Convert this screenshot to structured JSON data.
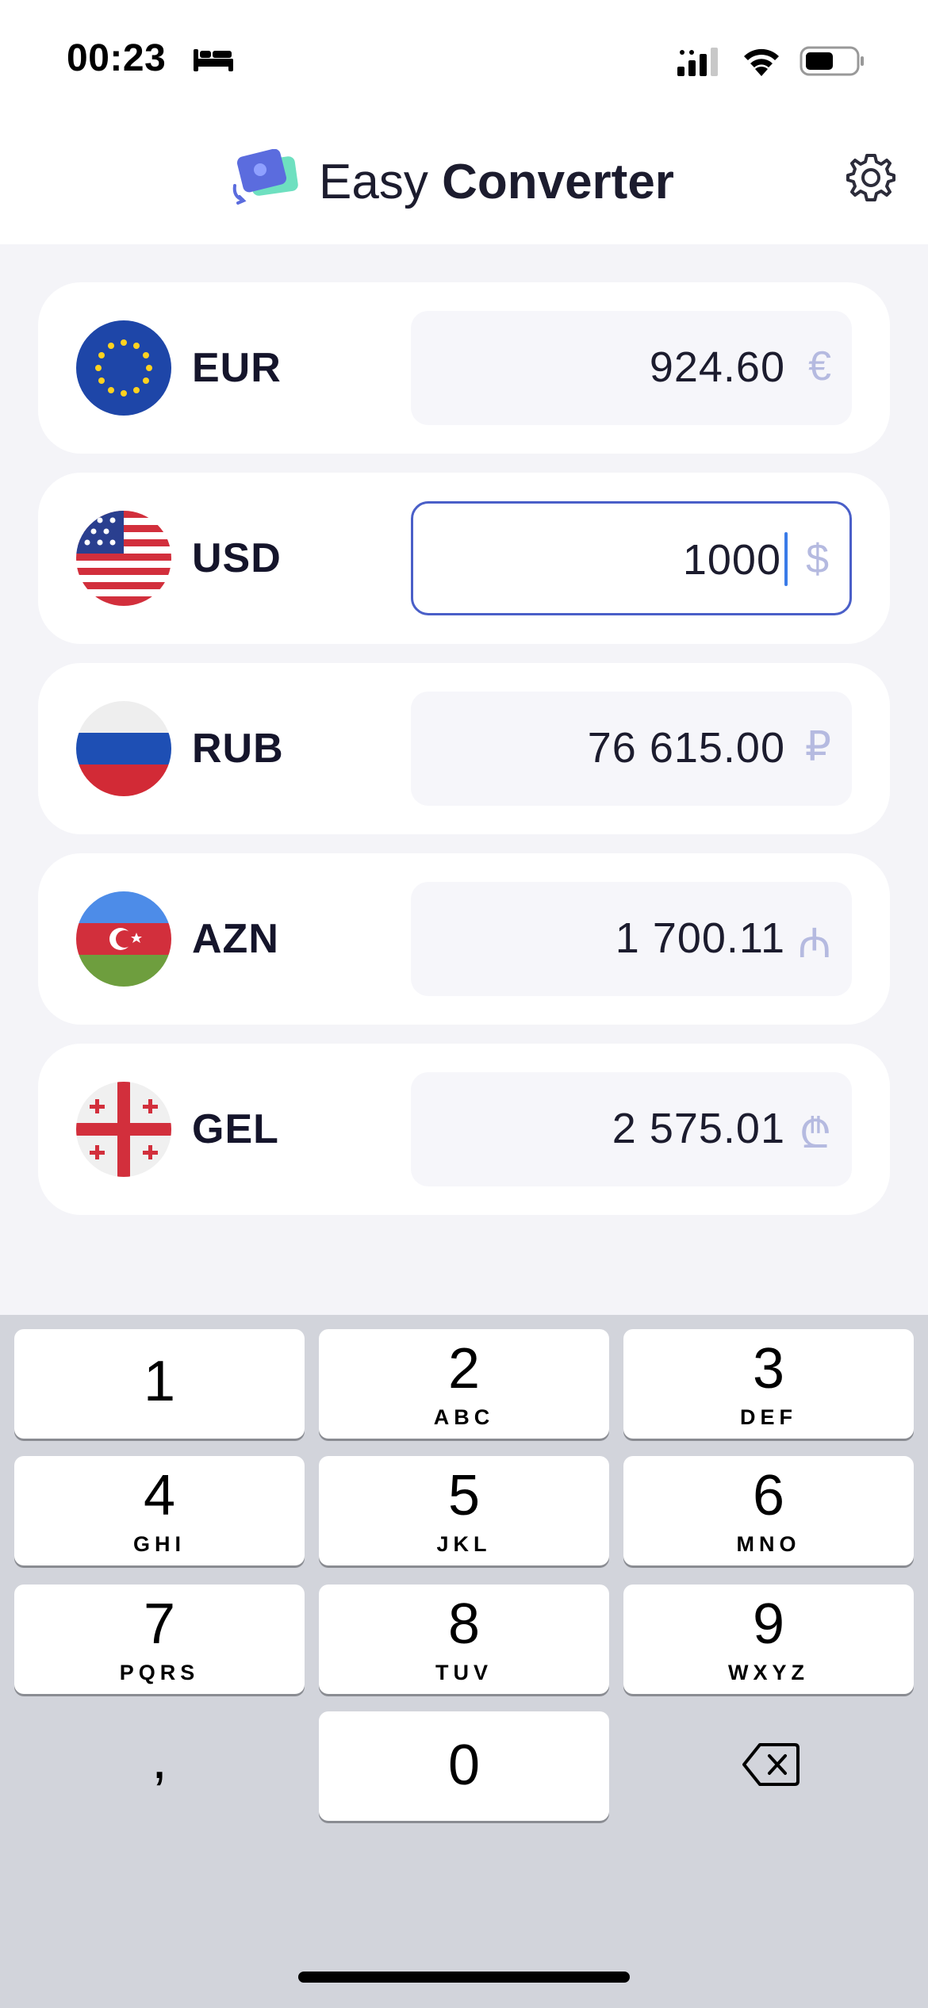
{
  "status_bar": {
    "time": "00:23"
  },
  "header": {
    "title_light": "Easy ",
    "title_bold": "Converter"
  },
  "currencies": [
    {
      "code": "EUR",
      "amount": "924.60",
      "symbol": "€",
      "active": false
    },
    {
      "code": "USD",
      "amount": "1000",
      "symbol": "$",
      "active": true
    },
    {
      "code": "RUB",
      "amount": "76 615.00",
      "symbol": "₽",
      "active": false
    },
    {
      "code": "AZN",
      "amount": "1 700.11",
      "symbol": "₼",
      "active": false
    },
    {
      "code": "GEL",
      "amount": "2 575.01",
      "symbol": "₾",
      "active": false
    }
  ],
  "keyboard": {
    "keys": [
      {
        "num": "1",
        "letters": ""
      },
      {
        "num": "2",
        "letters": "ABC"
      },
      {
        "num": "3",
        "letters": "DEF"
      },
      {
        "num": "4",
        "letters": "GHI"
      },
      {
        "num": "5",
        "letters": "JKL"
      },
      {
        "num": "6",
        "letters": "MNO"
      },
      {
        "num": "7",
        "letters": "PQRS"
      },
      {
        "num": "8",
        "letters": "TUV"
      },
      {
        "num": "9",
        "letters": "WXYZ"
      }
    ],
    "zero": "0",
    "comma": ","
  },
  "colors": {
    "accent": "#4a5fc8",
    "caret": "#3a7be8",
    "symbol": "#b5bae0"
  }
}
